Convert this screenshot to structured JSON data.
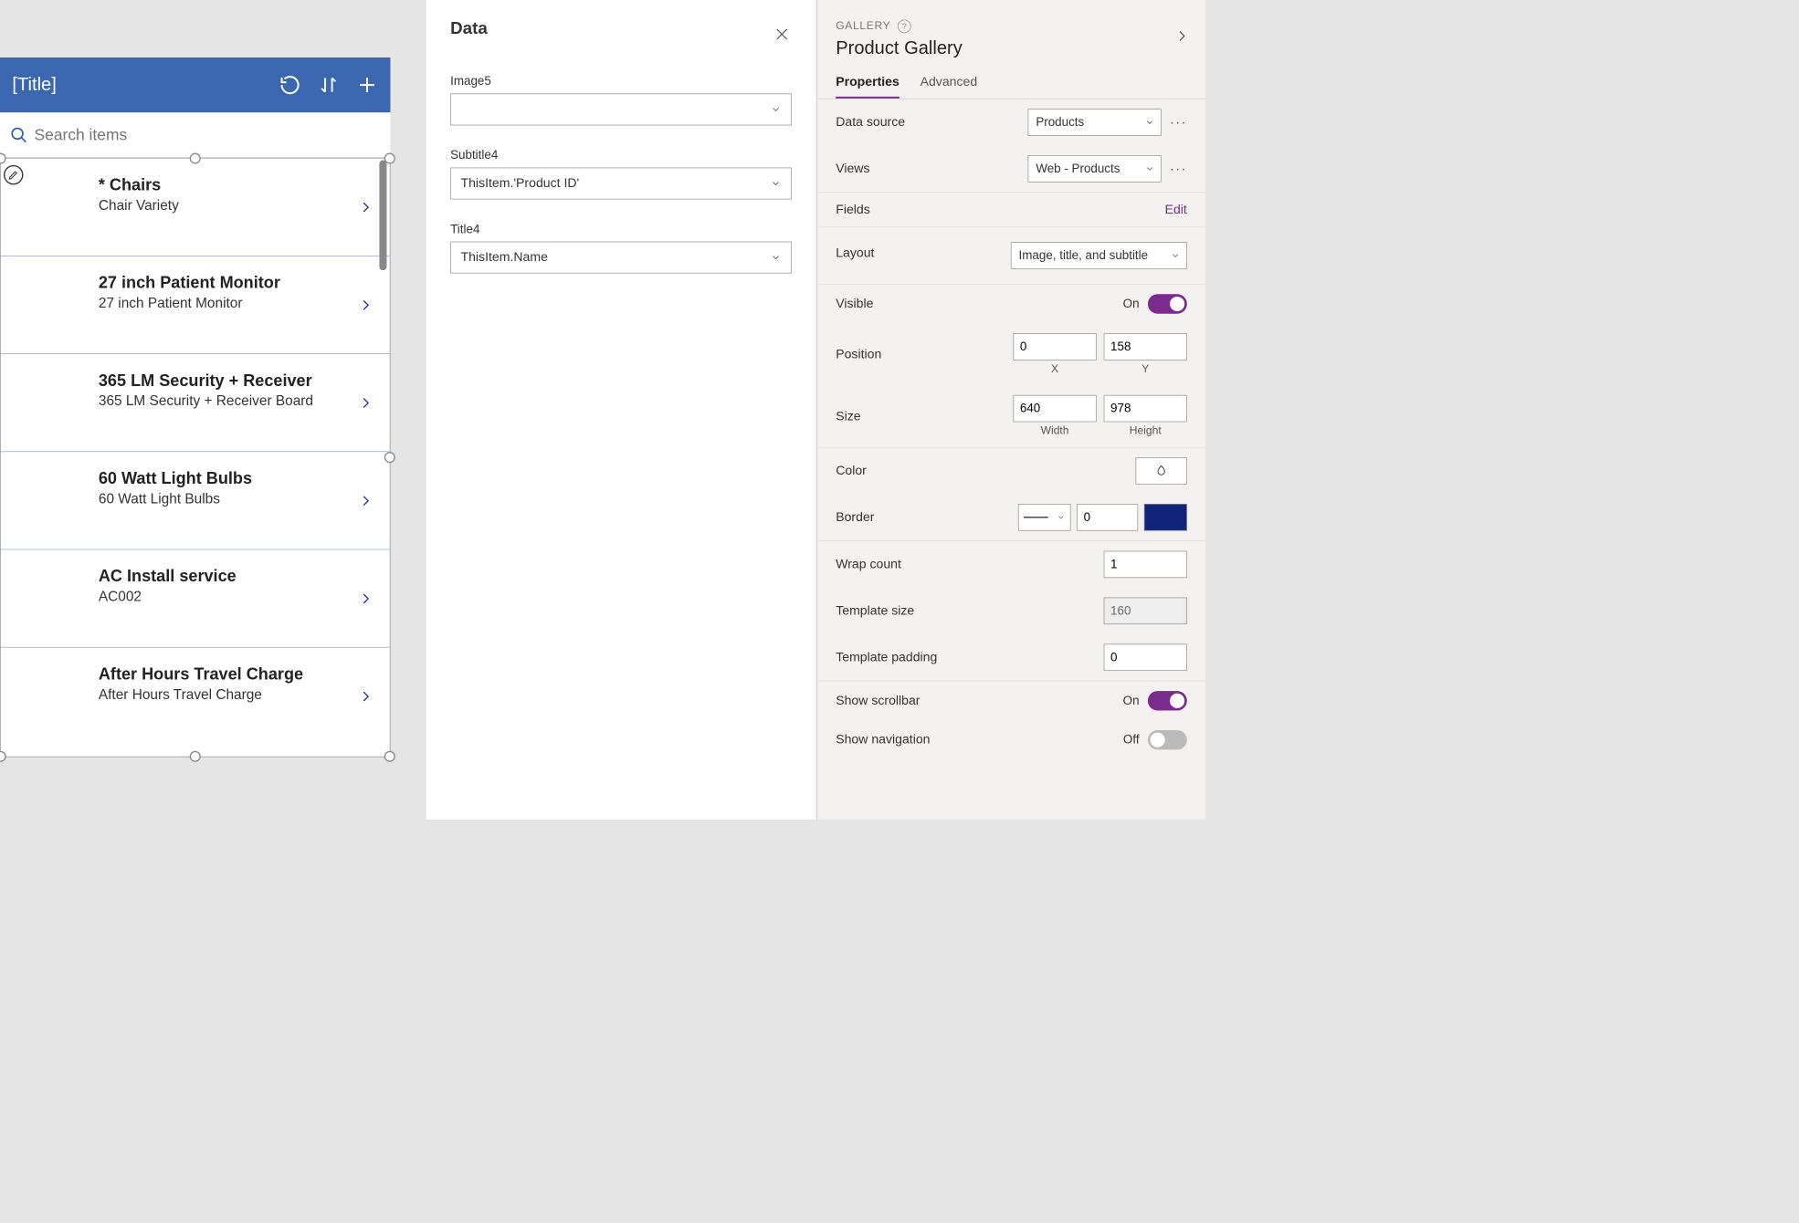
{
  "canvas": {
    "header": {
      "title": "[Title]"
    },
    "search": {
      "placeholder": "Search items"
    },
    "items": [
      {
        "title": "* Chairs",
        "subtitle": "Chair Variety"
      },
      {
        "title": "27 inch Patient Monitor",
        "subtitle": "27 inch Patient Monitor"
      },
      {
        "title": "365 LM Security + Receiver",
        "subtitle": "365 LM Security + Receiver Board"
      },
      {
        "title": "60 Watt Light Bulbs",
        "subtitle": "60 Watt Light Bulbs"
      },
      {
        "title": "AC Install service",
        "subtitle": "AC002"
      },
      {
        "title": "After Hours Travel Charge",
        "subtitle": "After Hours Travel Charge"
      }
    ]
  },
  "dataPanel": {
    "title": "Data",
    "fields": {
      "image": {
        "label": "Image5",
        "value": ""
      },
      "subtitle": {
        "label": "Subtitle4",
        "value": "ThisItem.'Product ID'"
      },
      "title": {
        "label": "Title4",
        "value": "ThisItem.Name"
      }
    }
  },
  "props": {
    "crumb": "GALLERY",
    "name": "Product Gallery",
    "tabs": {
      "properties": "Properties",
      "advanced": "Advanced"
    },
    "dataSource": {
      "label": "Data source",
      "value": "Products"
    },
    "views": {
      "label": "Views",
      "value": "Web - Products"
    },
    "fields": {
      "label": "Fields",
      "edit": "Edit"
    },
    "layout": {
      "label": "Layout",
      "value": "Image, title, and subtitle"
    },
    "visible": {
      "label": "Visible",
      "text": "On",
      "on": true
    },
    "position": {
      "label": "Position",
      "x": "0",
      "y": "158",
      "xcap": "X",
      "ycap": "Y"
    },
    "size": {
      "label": "Size",
      "w": "640",
      "h": "978",
      "wcap": "Width",
      "hcap": "Height"
    },
    "color": {
      "label": "Color"
    },
    "border": {
      "label": "Border",
      "width": "0",
      "colorHex": "#10247a"
    },
    "wrapCount": {
      "label": "Wrap count",
      "value": "1"
    },
    "templateSize": {
      "label": "Template size",
      "value": "160"
    },
    "templatePad": {
      "label": "Template padding",
      "value": "0"
    },
    "scrollbar": {
      "label": "Show scrollbar",
      "text": "On",
      "on": true
    },
    "showNav": {
      "label": "Show navigation",
      "text": "Off",
      "on": false
    }
  }
}
